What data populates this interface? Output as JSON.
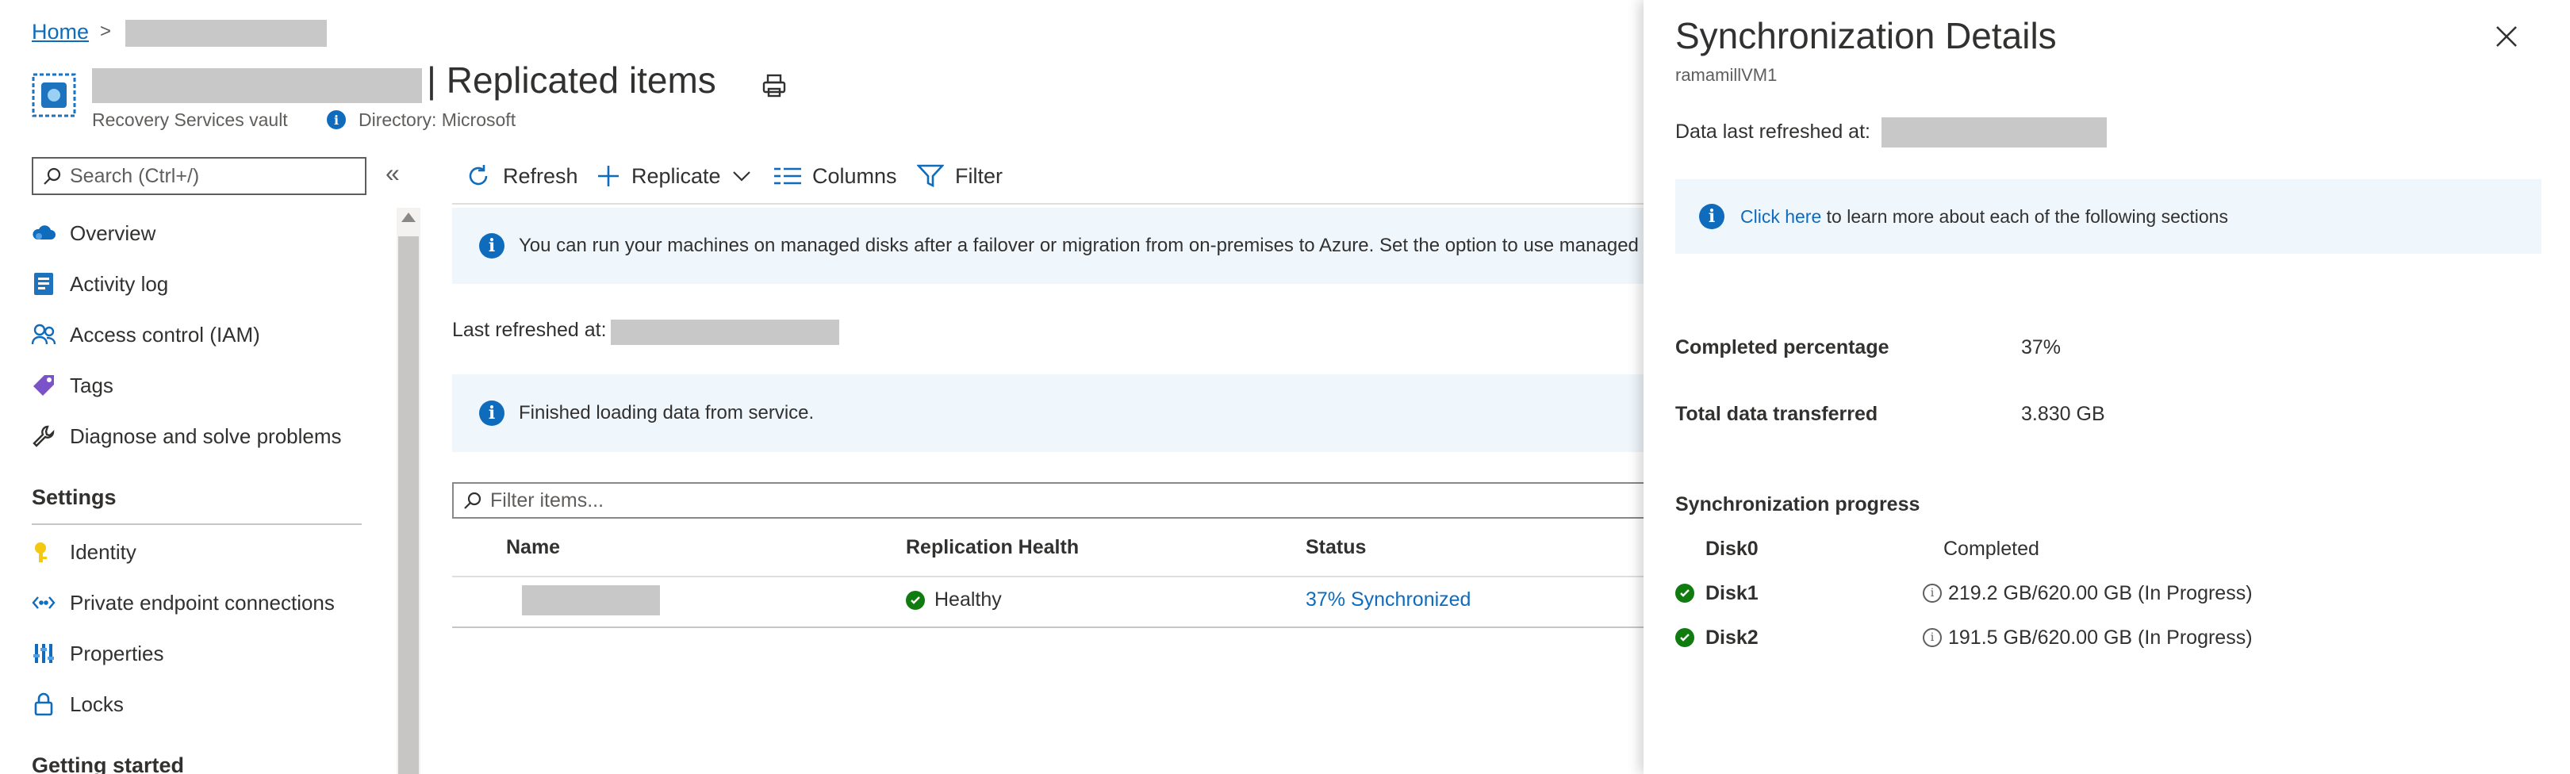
{
  "breadcrumb": {
    "home": "Home"
  },
  "header": {
    "title_suffix": "| Replicated items",
    "subtitle": "Recovery Services vault",
    "directory": "Directory: Microsoft"
  },
  "sidebar": {
    "search_placeholder": "Search (Ctrl+/)",
    "collapse": "«",
    "items": [
      {
        "label": "Overview",
        "icon": "cloud-icon"
      },
      {
        "label": "Activity log",
        "icon": "log-icon"
      },
      {
        "label": "Access control (IAM)",
        "icon": "people-icon"
      },
      {
        "label": "Tags",
        "icon": "tag-icon"
      },
      {
        "label": "Diagnose and solve problems",
        "icon": "wrench-icon"
      }
    ],
    "settings_heading": "Settings",
    "settings_items": [
      {
        "label": "Identity",
        "icon": "key-icon"
      },
      {
        "label": "Private endpoint connections",
        "icon": "endpoint-icon"
      },
      {
        "label": "Properties",
        "icon": "properties-icon"
      },
      {
        "label": "Locks",
        "icon": "lock-icon"
      }
    ],
    "getting_started_heading": "Getting started"
  },
  "toolbar": {
    "refresh": "Refresh",
    "replicate": "Replicate",
    "columns": "Columns",
    "filter": "Filter"
  },
  "banners": {
    "managed_disks": "You can run your machines on managed disks after a failover or migration from on-premises to Azure. Set the option to use managed",
    "loaded": "Finished loading data from service."
  },
  "last_refreshed_label": "Last refreshed at:",
  "filter_placeholder": "Filter items...",
  "table": {
    "columns": [
      "Name",
      "Replication Health",
      "Status"
    ],
    "rows": [
      {
        "health": "Healthy",
        "status": "37% Synchronized"
      }
    ]
  },
  "panel": {
    "title": "Synchronization Details",
    "subtitle": "ramamillVM1",
    "refreshed_label": "Data last refreshed at:",
    "info_link": "Click here",
    "info_text": " to learn more about each of the following sections",
    "completed_label": "Completed percentage",
    "completed_value": "37%",
    "transferred_label": "Total data transferred",
    "transferred_value": "3.830 GB",
    "progress_heading": "Synchronization progress",
    "disks": [
      {
        "name": "Disk0",
        "status": "Completed",
        "check": false,
        "info": false
      },
      {
        "name": "Disk1",
        "status": "219.2 GB/620.00 GB (In Progress)",
        "check": true,
        "info": true
      },
      {
        "name": "Disk2",
        "status": "191.5 GB/620.00 GB (In Progress)",
        "check": true,
        "info": true
      }
    ]
  },
  "colors": {
    "accent": "#0f6cbd",
    "success": "#107c10",
    "banner": "#eff6fc"
  }
}
